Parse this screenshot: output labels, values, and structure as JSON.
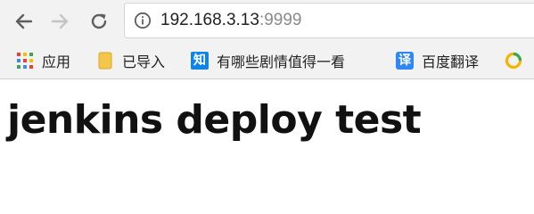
{
  "address_bar": {
    "host": "192.168.3.13",
    "port": ":9999"
  },
  "bookmarks": [
    {
      "label": "应用",
      "icon": "apps-grid-icon"
    },
    {
      "label": "已导入",
      "icon": "folder-icon"
    },
    {
      "label": "有哪些剧情值得一看",
      "icon": "zhihu-icon",
      "icon_text": "知"
    },
    {
      "label": "百度翻译",
      "icon": "baidu-translate-icon",
      "icon_text": "译"
    },
    {
      "label": "",
      "icon": "circle-logo-icon"
    }
  ],
  "page": {
    "title": "jenkins deploy test"
  },
  "colors": {
    "toolbar_bg": "#f2f2f2",
    "zhihu_blue": "#0e83e8",
    "baidu_blue": "#2f86f6",
    "folder_yellow": "#f6c64b"
  }
}
